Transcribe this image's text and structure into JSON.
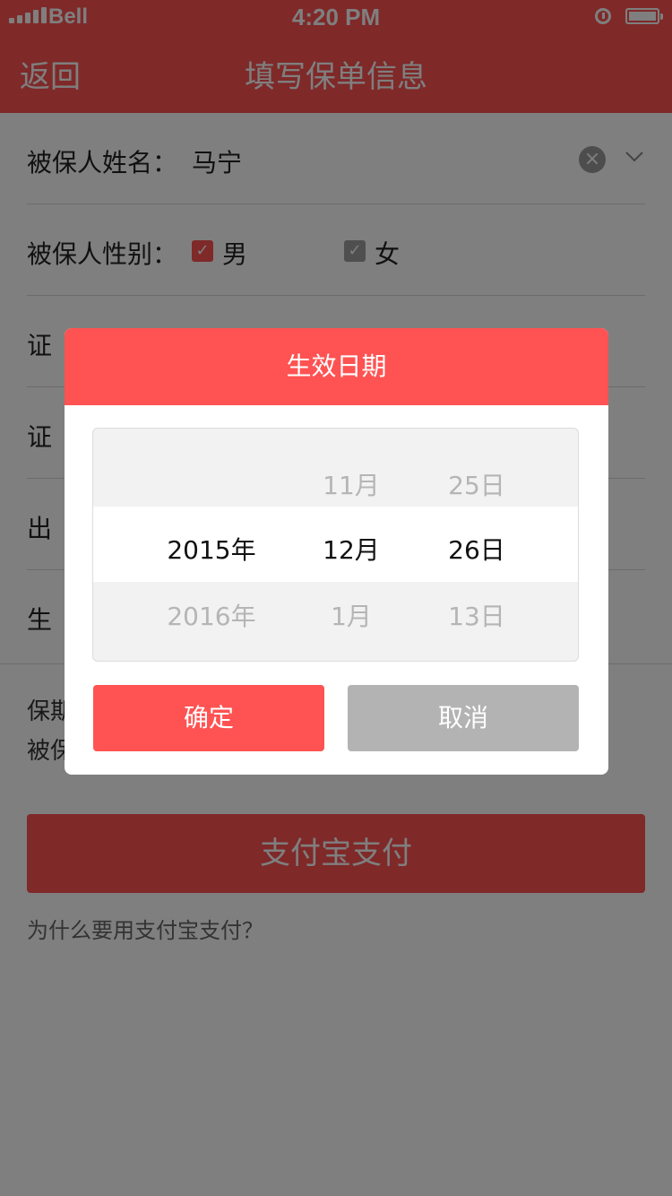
{
  "status_bar": {
    "carrier": "Bell",
    "time": "4:20 PM"
  },
  "nav": {
    "back_label": "返回",
    "title": "填写保单信息"
  },
  "form": {
    "name_label": "被保人姓名：",
    "name_value": "马宁",
    "gender_label": "被保人性别：",
    "gender_male": "男",
    "gender_female": "女",
    "row3_label": "证",
    "row4_label": "证",
    "row5_label": "出",
    "row6_label": "生"
  },
  "info": {
    "line1": "保期",
    "line2": "被保"
  },
  "pay_button": "支付宝支付",
  "why_link": "为什么要用支付宝支付？",
  "modal": {
    "title": "生效日期",
    "picker": {
      "years": [
        "",
        "2015年",
        "2016年"
      ],
      "months": [
        "11月",
        "12月",
        "1月"
      ],
      "days": [
        "25日",
        "26日",
        "13日"
      ]
    },
    "confirm_label": "确定",
    "cancel_label": "取消"
  },
  "colors": {
    "accent": "#ff5252",
    "cancel": "#b3b3b3"
  }
}
